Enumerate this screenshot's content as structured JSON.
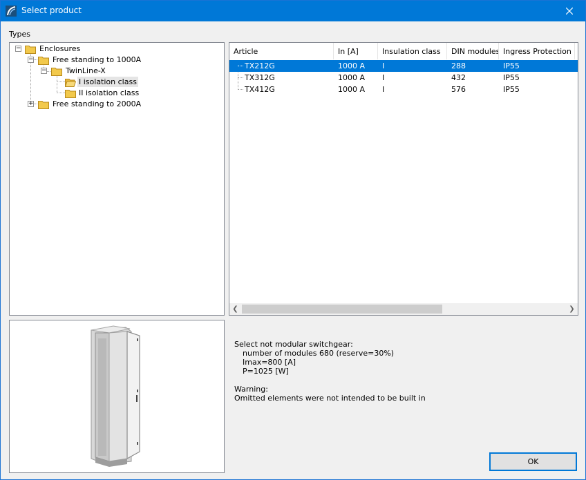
{
  "window": {
    "title": "Select product"
  },
  "types_label": "Types",
  "tree": [
    {
      "label": "Enclosures",
      "expander": "−",
      "level": 0,
      "selected": false
    },
    {
      "label": "Free standing to 1000A",
      "expander": "−",
      "level": 1,
      "selected": false
    },
    {
      "label": "TwinLine-X",
      "expander": "−",
      "level": 2,
      "selected": false
    },
    {
      "label": "I isolation class",
      "expander": "",
      "level": 3,
      "selected": true,
      "open_folder": true
    },
    {
      "label": "II isolation class",
      "expander": "",
      "level": 3,
      "selected": false
    },
    {
      "label": "Free standing to 2000A",
      "expander": "+",
      "level": 1,
      "selected": false
    }
  ],
  "list": {
    "columns": [
      "Article",
      "In [A]",
      "Insulation class",
      "DIN modules",
      "Ingress Protection"
    ],
    "rows": [
      {
        "article": "TX212G",
        "in": "1000 A",
        "insulation": "I",
        "din": "288",
        "ip": "IP55",
        "selected": true
      },
      {
        "article": "TX312G",
        "in": "1000 A",
        "insulation": "I",
        "din": "432",
        "ip": "IP55",
        "selected": false
      },
      {
        "article": "TX412G",
        "in": "1000 A",
        "insulation": "I",
        "din": "576",
        "ip": "IP55",
        "selected": false
      }
    ]
  },
  "info": {
    "heading": "Select not modular switchgear:",
    "modules": "number of modules 680 (reserve=30%)",
    "imax": "Imax=800 [A]",
    "power": "P=1025 [W]",
    "warning_title": "Warning:",
    "warning_text": "Omitted elements were not intended to be built in"
  },
  "ok_label": "OK",
  "colors": {
    "titlebar": "#0078d7",
    "selection": "#0078d7",
    "folder": "#f2c94c"
  },
  "icons": {
    "app": "switchgear-app-icon",
    "close": "close-icon",
    "folder": "folder-icon",
    "scroll_left": "chevron-left-icon",
    "scroll_right": "chevron-right-icon"
  }
}
